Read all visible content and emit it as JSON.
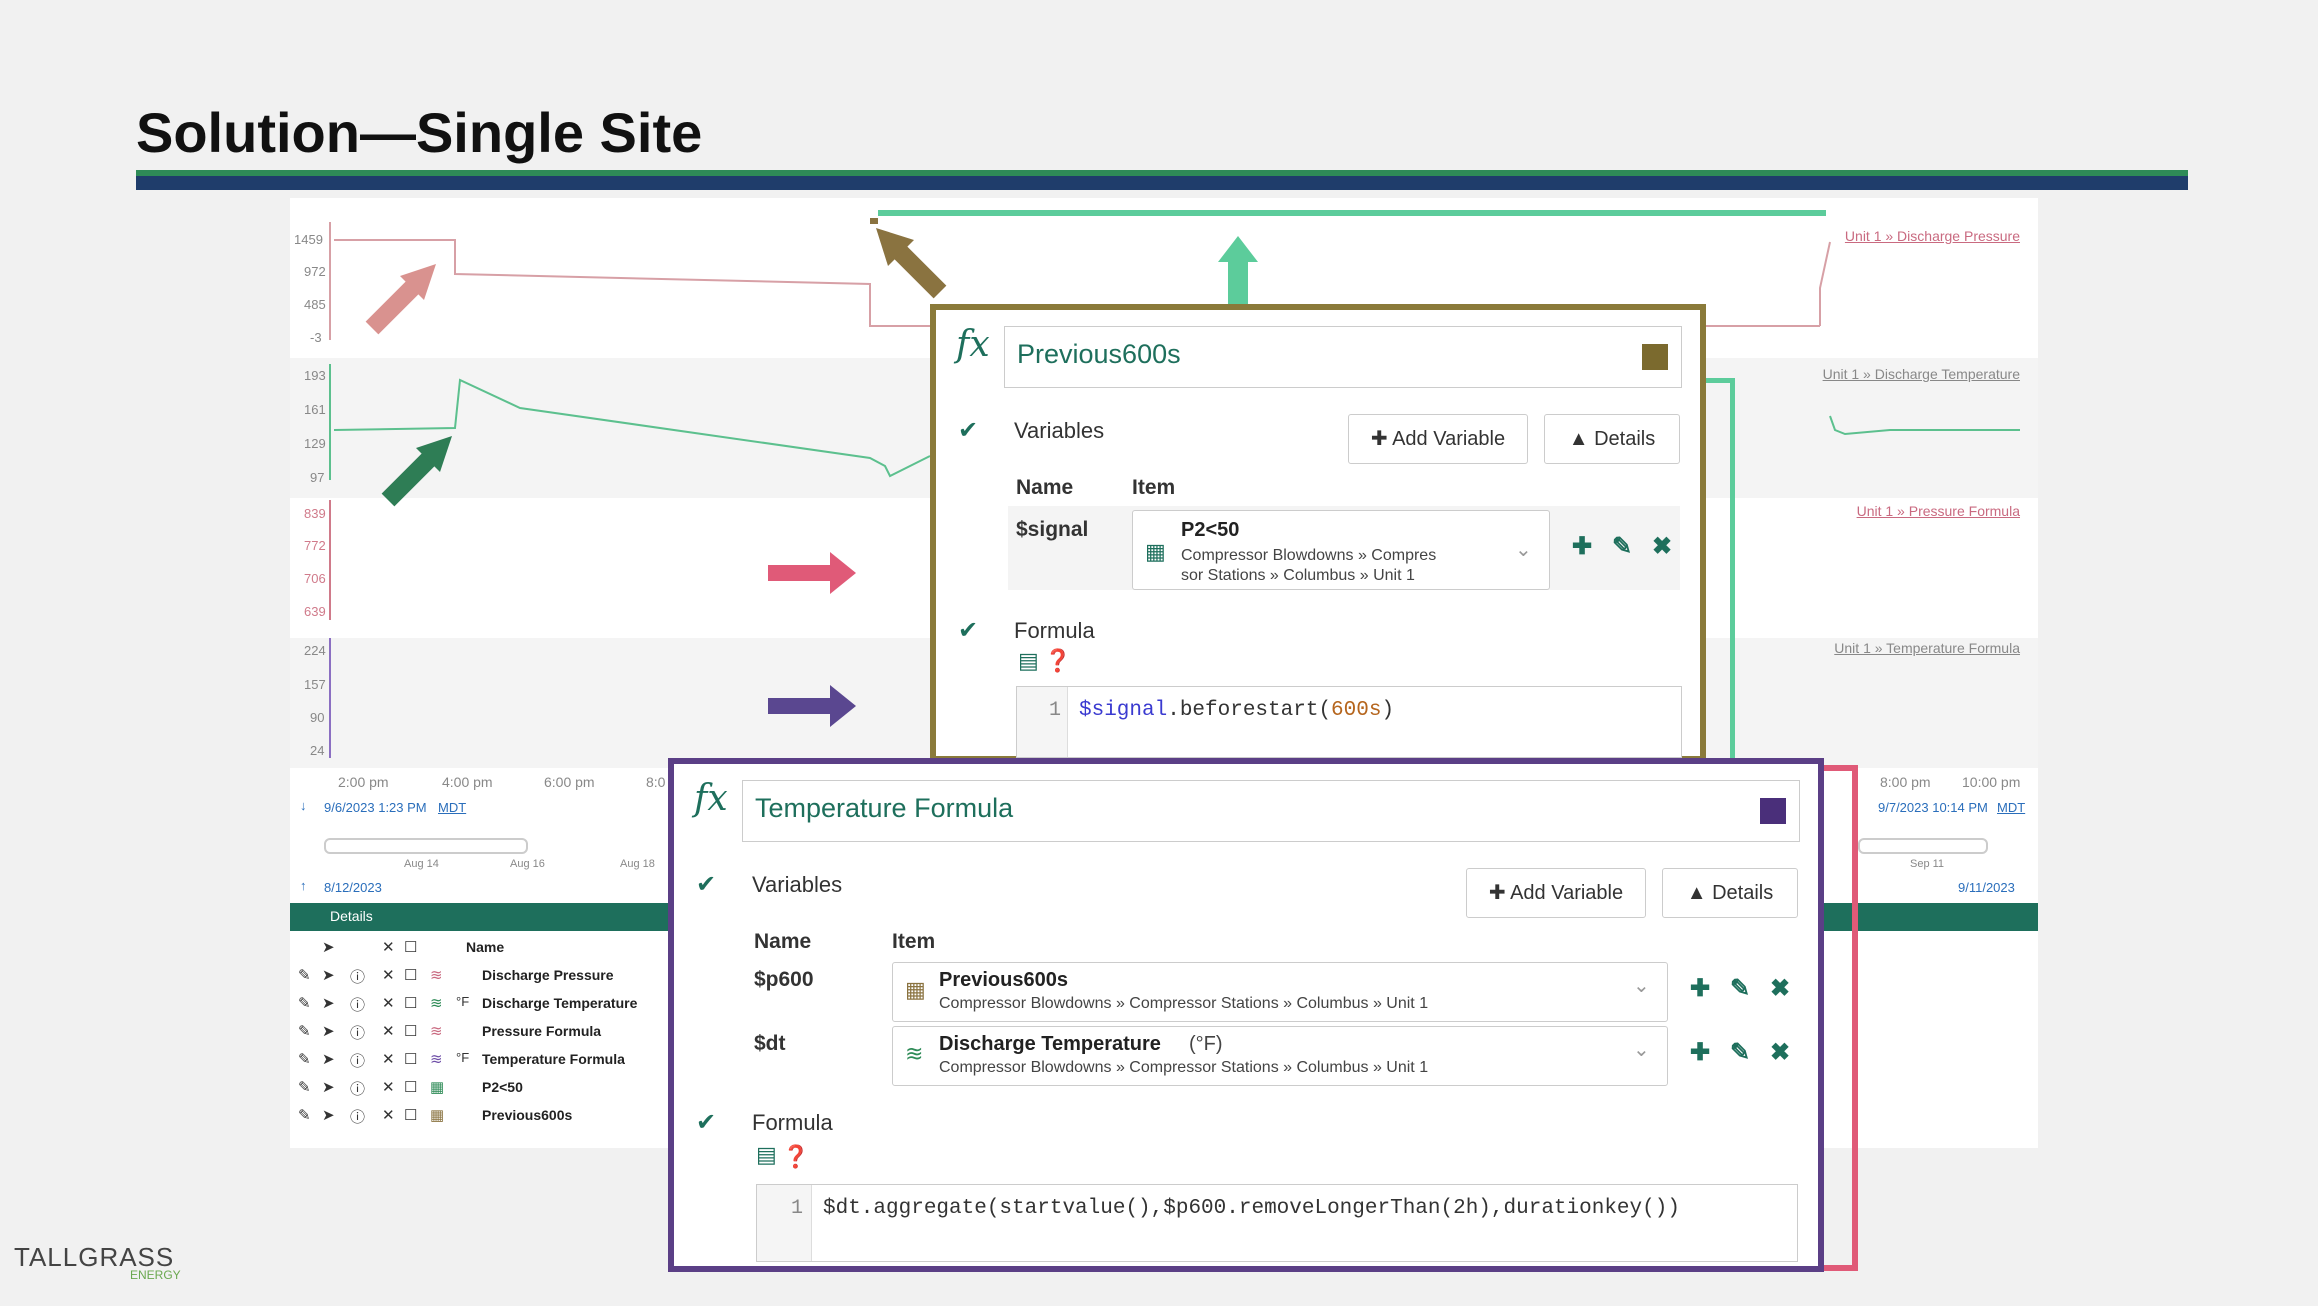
{
  "slide": {
    "title": "Solution—Single Site",
    "colors": {
      "rule_dark": "#1f3d6b",
      "rule_green": "#2e8b57"
    }
  },
  "trend": {
    "lanes": [
      {
        "label": "Unit 1 » Discharge Pressure",
        "ticks": [
          "1459",
          "972",
          "485",
          "-3"
        ]
      },
      {
        "label": "Unit 1 » Discharge Temperature",
        "ticks": [
          "193",
          "161",
          "129",
          "97"
        ]
      },
      {
        "label": "Unit 1 » Pressure Formula",
        "ticks": [
          "839",
          "772",
          "706",
          "639"
        ]
      },
      {
        "label": "Unit 1 » Temperature Formula",
        "ticks": [
          "224",
          "157",
          "90",
          "24"
        ]
      }
    ],
    "x_ticks_left": [
      "2:00 pm",
      "4:00 pm",
      "6:00 pm",
      "8:0"
    ],
    "x_ticks_right": [
      "8:00 pm",
      "10:00 pm"
    ],
    "start_time": "9/6/2023 1:23 PM",
    "end_time": "9/7/2023 10:14 PM",
    "tz": "MDT",
    "nav_ticks_left": [
      "Aug 14",
      "Aug 16",
      "Aug 18"
    ],
    "nav_tick_right": "Sep 11",
    "nav_start": "8/12/2023",
    "nav_end": "9/11/2023",
    "details_label": "Details",
    "table_header_name": "Name",
    "rows": [
      {
        "name": "Discharge Pressure",
        "unit": ""
      },
      {
        "name": "Discharge Temperature",
        "unit": "°F"
      },
      {
        "name": "Pressure Formula",
        "unit": ""
      },
      {
        "name": "Temperature Formula",
        "unit": "°F"
      },
      {
        "name": "P2<50",
        "unit": ""
      },
      {
        "name": "Previous600s",
        "unit": ""
      }
    ]
  },
  "panel_top": {
    "name": "Previous600s",
    "swatch_color": "#7b6a2e",
    "border_color": "#8a7a3a",
    "variables_label": "Variables",
    "add_variable": "Add Variable",
    "details": "Details",
    "col_name": "Name",
    "col_item": "Item",
    "variables": [
      {
        "var": "$signal",
        "item": "P2<50",
        "path_line1": "Compressor Blowdowns » Compres",
        "path_line2": "sor Stations » Columbus » Unit 1"
      }
    ],
    "formula_label": "Formula",
    "code_line_no": "1",
    "code": {
      "var": "$signal",
      "fn": ".beforestart(",
      "arg": "600s",
      "close": ")"
    }
  },
  "panel_bottom": {
    "name": "Temperature Formula",
    "swatch_color": "#4a2f7a",
    "border_color": "#5b3f86",
    "variables_label": "Variables",
    "add_variable": "Add Variable",
    "details": "Details",
    "col_name": "Name",
    "col_item": "Item",
    "variables": [
      {
        "var": "$p600",
        "item": "Previous600s",
        "unit": "",
        "path": "Compressor Blowdowns » Compressor Stations » Columbus » Unit 1"
      },
      {
        "var": "$dt",
        "item": "Discharge Temperature",
        "unit": "(°F)",
        "path": "Compressor Blowdowns » Compressor Stations » Columbus » Unit 1"
      }
    ],
    "formula_label": "Formula",
    "code_line_no": "1",
    "code": "$dt.aggregate(startvalue(),$p600.removeLongerThan(2h),durationkey())"
  },
  "arrows": {
    "pink_light": "#d9928f",
    "green_dark": "#2e7d55",
    "pink_strong": "#e05a78",
    "purple": "#5a4790",
    "brown": "#8a7340",
    "teal": "#5ccc9b"
  },
  "logo": {
    "text": "TALLGRASS",
    "sub": "ENERGY"
  }
}
